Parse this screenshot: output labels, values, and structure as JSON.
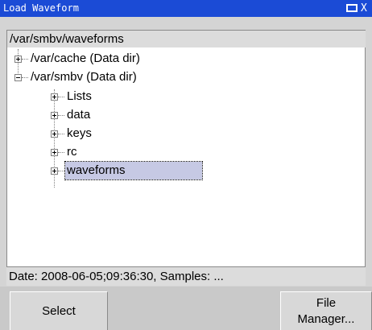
{
  "window": {
    "title": "Load Waveform",
    "maximize_icon": "maximize-icon",
    "close_glyph": "X"
  },
  "path_bar": {
    "path": "/var/smbv/waveforms"
  },
  "tree": {
    "nodes": [
      {
        "label": "/var/cache (Data dir)",
        "expander": "plus",
        "level": 0
      },
      {
        "label": "/var/smbv (Data dir)",
        "expander": "minus",
        "level": 0
      },
      {
        "label": "Lists",
        "expander": "plus",
        "level": 1
      },
      {
        "label": "data",
        "expander": "plus",
        "level": 1
      },
      {
        "label": "keys",
        "expander": "plus",
        "level": 1
      },
      {
        "label": "rc",
        "expander": "plus",
        "level": 1
      },
      {
        "label": "waveforms",
        "expander": "plus",
        "level": 1,
        "selected": true
      }
    ]
  },
  "status": {
    "text": "Date: 2008-06-05;09:36:30, Samples: ..."
  },
  "buttons": {
    "select": "Select",
    "file_manager_line1": "File",
    "file_manager_line2": "Manager..."
  },
  "colors": {
    "titlebar": "#1b4bd6",
    "selection": "#c6c9e4",
    "panel": "#d4d4d4"
  }
}
